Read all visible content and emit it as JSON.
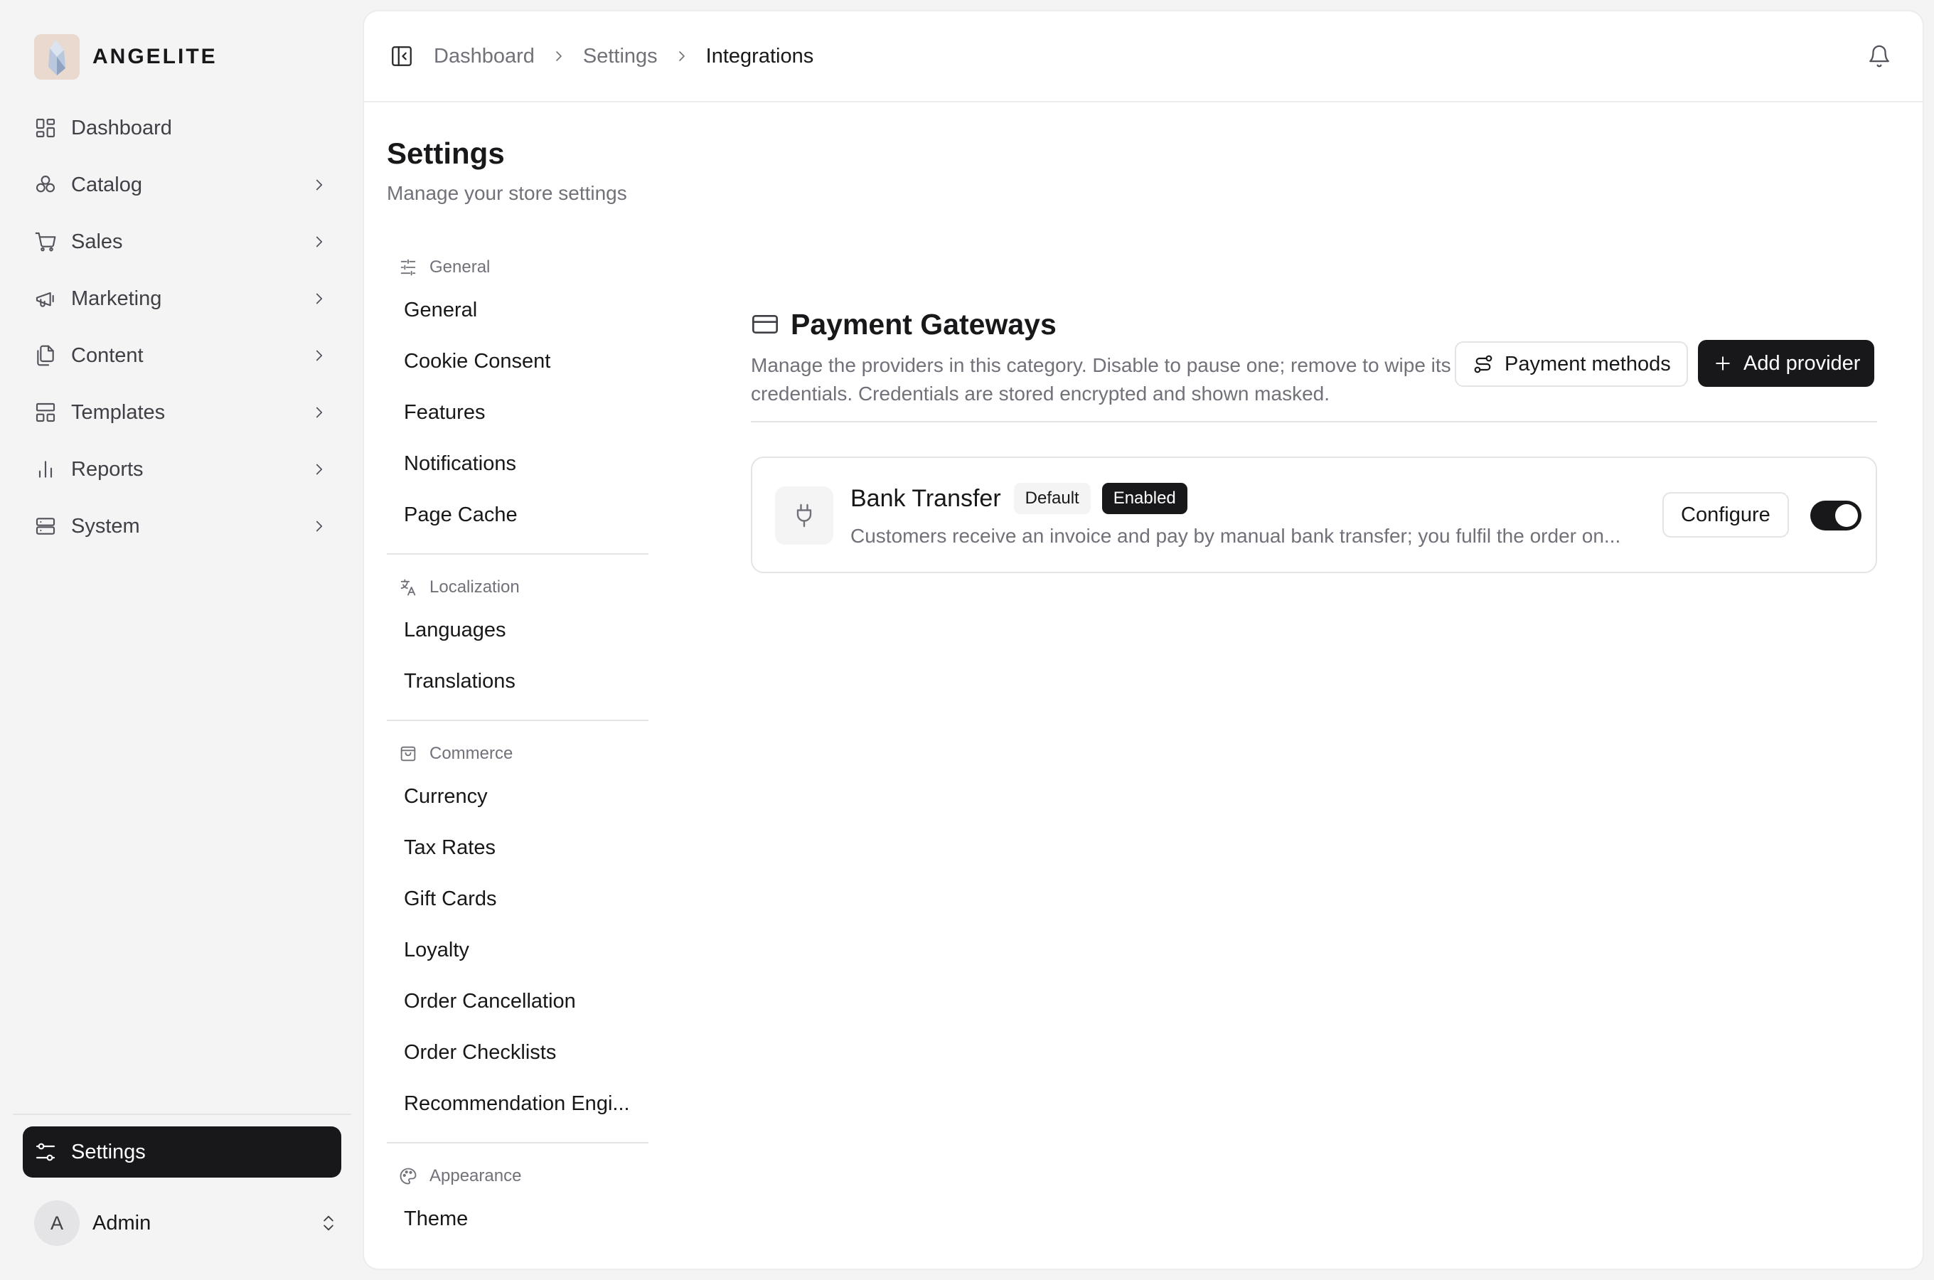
{
  "brand": {
    "name": "ANGELITE"
  },
  "sidebar": {
    "items": [
      {
        "label": "Dashboard",
        "icon": "dashboard-icon",
        "has_chevron": false
      },
      {
        "label": "Catalog",
        "icon": "catalog-icon",
        "has_chevron": true
      },
      {
        "label": "Sales",
        "icon": "cart-icon",
        "has_chevron": true
      },
      {
        "label": "Marketing",
        "icon": "megaphone-icon",
        "has_chevron": true
      },
      {
        "label": "Content",
        "icon": "files-icon",
        "has_chevron": true
      },
      {
        "label": "Templates",
        "icon": "layout-icon",
        "has_chevron": true
      },
      {
        "label": "Reports",
        "icon": "bar-chart-icon",
        "has_chevron": true
      },
      {
        "label": "System",
        "icon": "server-icon",
        "has_chevron": true
      }
    ],
    "settings_label": "Settings",
    "user": {
      "initial": "A",
      "name": "Admin"
    }
  },
  "breadcrumb": [
    "Dashboard",
    "Settings",
    "Integrations"
  ],
  "page": {
    "title": "Settings",
    "subtitle": "Manage your store settings"
  },
  "settings_nav": {
    "groups": [
      {
        "heading": "General",
        "icon": "sliders-icon",
        "items": [
          "General",
          "Cookie Consent",
          "Features",
          "Notifications",
          "Page Cache"
        ]
      },
      {
        "heading": "Localization",
        "icon": "translate-icon",
        "items": [
          "Languages",
          "Translations"
        ]
      },
      {
        "heading": "Commerce",
        "icon": "shopping-bag-icon",
        "items": [
          "Currency",
          "Tax Rates",
          "Gift Cards",
          "Loyalty",
          "Order Cancellation",
          "Order Checklists",
          "Recommendation Engi..."
        ]
      },
      {
        "heading": "Appearance",
        "icon": "palette-icon",
        "items": [
          "Theme"
        ]
      }
    ]
  },
  "section": {
    "title": "Payment Gateways",
    "description": "Manage the providers in this category. Disable to pause one; remove to wipe its credentials. Credentials are stored encrypted and shown masked.",
    "payment_methods_label": "Payment methods",
    "add_provider_label": "Add provider"
  },
  "gateways": [
    {
      "name": "Bank Transfer",
      "badge_default": "Default",
      "badge_status": "Enabled",
      "description": "Customers receive an invoice and pay by manual bank transfer; you fulfil the order on...",
      "configure_label": "Configure",
      "enabled": true
    }
  ],
  "colors": {
    "accent": "#18181b",
    "muted_text": "#71717a",
    "border": "#e4e4e7",
    "background": "#f4f4f5"
  }
}
